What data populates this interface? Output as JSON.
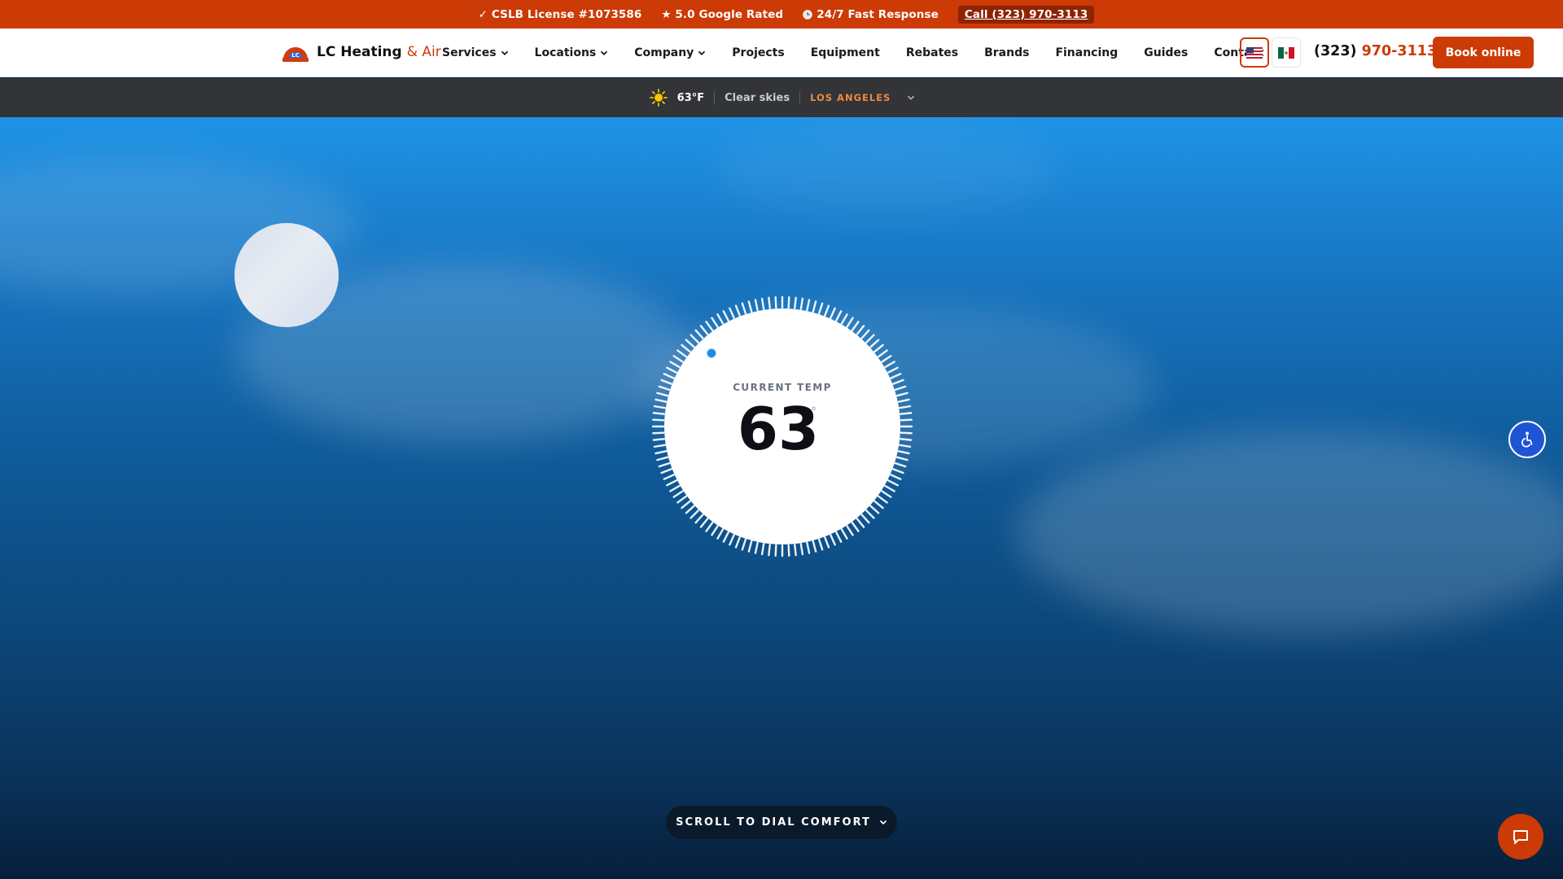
{
  "topbar": {
    "license": "✓ CSLB License #1073586",
    "rating": "★ 5.0 Google Rated",
    "response_icon": "clock-icon",
    "response": "24/7 Fast Response",
    "call": "Call (323) 970-3113"
  },
  "nav": {
    "logo_name": "LC Heating",
    "logo_accent": "& Air",
    "links": [
      {
        "label": "Services",
        "has_dropdown": true
      },
      {
        "label": "Locations",
        "has_dropdown": true
      },
      {
        "label": "Company",
        "has_dropdown": true
      },
      {
        "label": "Projects",
        "has_dropdown": false
      },
      {
        "label": "Equipment",
        "has_dropdown": false
      },
      {
        "label": "Rebates",
        "has_dropdown": false
      },
      {
        "label": "Brands",
        "has_dropdown": false
      },
      {
        "label": "Financing",
        "has_dropdown": false
      },
      {
        "label": "Guides",
        "has_dropdown": false
      },
      {
        "label": "Contact",
        "has_dropdown": false
      }
    ],
    "languages": [
      {
        "icon": "us-flag-icon",
        "selected": true
      },
      {
        "icon": "mexico-flag-icon",
        "selected": false
      }
    ],
    "phone_area": "(323)",
    "phone_number": "970-3113",
    "book_label": "Book online"
  },
  "weather": {
    "icon": "sun-icon",
    "temp": "63°F",
    "condition": "Clear skies",
    "city": "LOS ANGELES"
  },
  "hero": {
    "dial_label": "CURRENT TEMP",
    "dial_value": "63",
    "dial_unit": "°",
    "scroll_label": "SCROLL TO DIAL COMFORT"
  },
  "colors": {
    "brand": "#cc3a06",
    "weather_bar": "#323438",
    "accessibility": "#1e54d6"
  }
}
